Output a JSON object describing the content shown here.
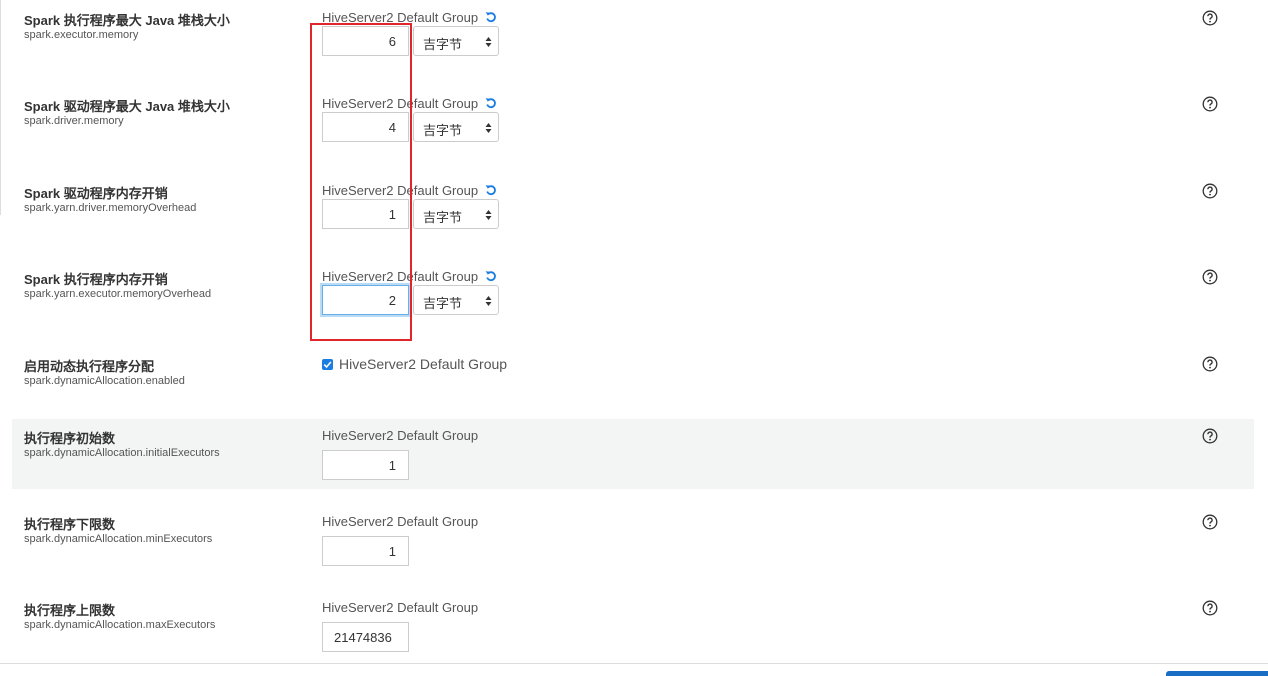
{
  "group_name": "HiveServer2 Default Group",
  "unit_label": "吉字节",
  "properties": [
    {
      "title": "Spark 执行程序最大 Java 堆栈大小",
      "key": "spark.executor.memory",
      "value": "6"
    },
    {
      "title": "Spark 驱动程序最大 Java 堆栈大小",
      "key": "spark.driver.memory",
      "value": "4"
    },
    {
      "title": "Spark 驱动程序内存开销",
      "key": "spark.yarn.driver.memoryOverhead",
      "value": "1"
    },
    {
      "title": "Spark 执行程序内存开销",
      "key": "spark.yarn.executor.memoryOverhead",
      "value": "2"
    },
    {
      "title": "启用动态执行程序分配",
      "key": "spark.dynamicAllocation.enabled",
      "checked": true
    },
    {
      "title": "执行程序初始数",
      "key": "spark.dynamicAllocation.initialExecutors",
      "value": "1"
    },
    {
      "title": "执行程序下限数",
      "key": "spark.dynamicAllocation.minExecutors",
      "value": "1"
    },
    {
      "title": "执行程序上限数",
      "key": "spark.dynamicAllocation.maxExecutors",
      "value": "21474836"
    }
  ],
  "colors": {
    "accent": "#1a7de1",
    "highlight": "#e0262a",
    "shaded_row": "#f3f4f4"
  },
  "icons": {
    "undo": "undo-icon",
    "help": "question-circle-icon",
    "select_arrows": "sort-icon",
    "checkbox": "checkbox-checked-icon"
  }
}
